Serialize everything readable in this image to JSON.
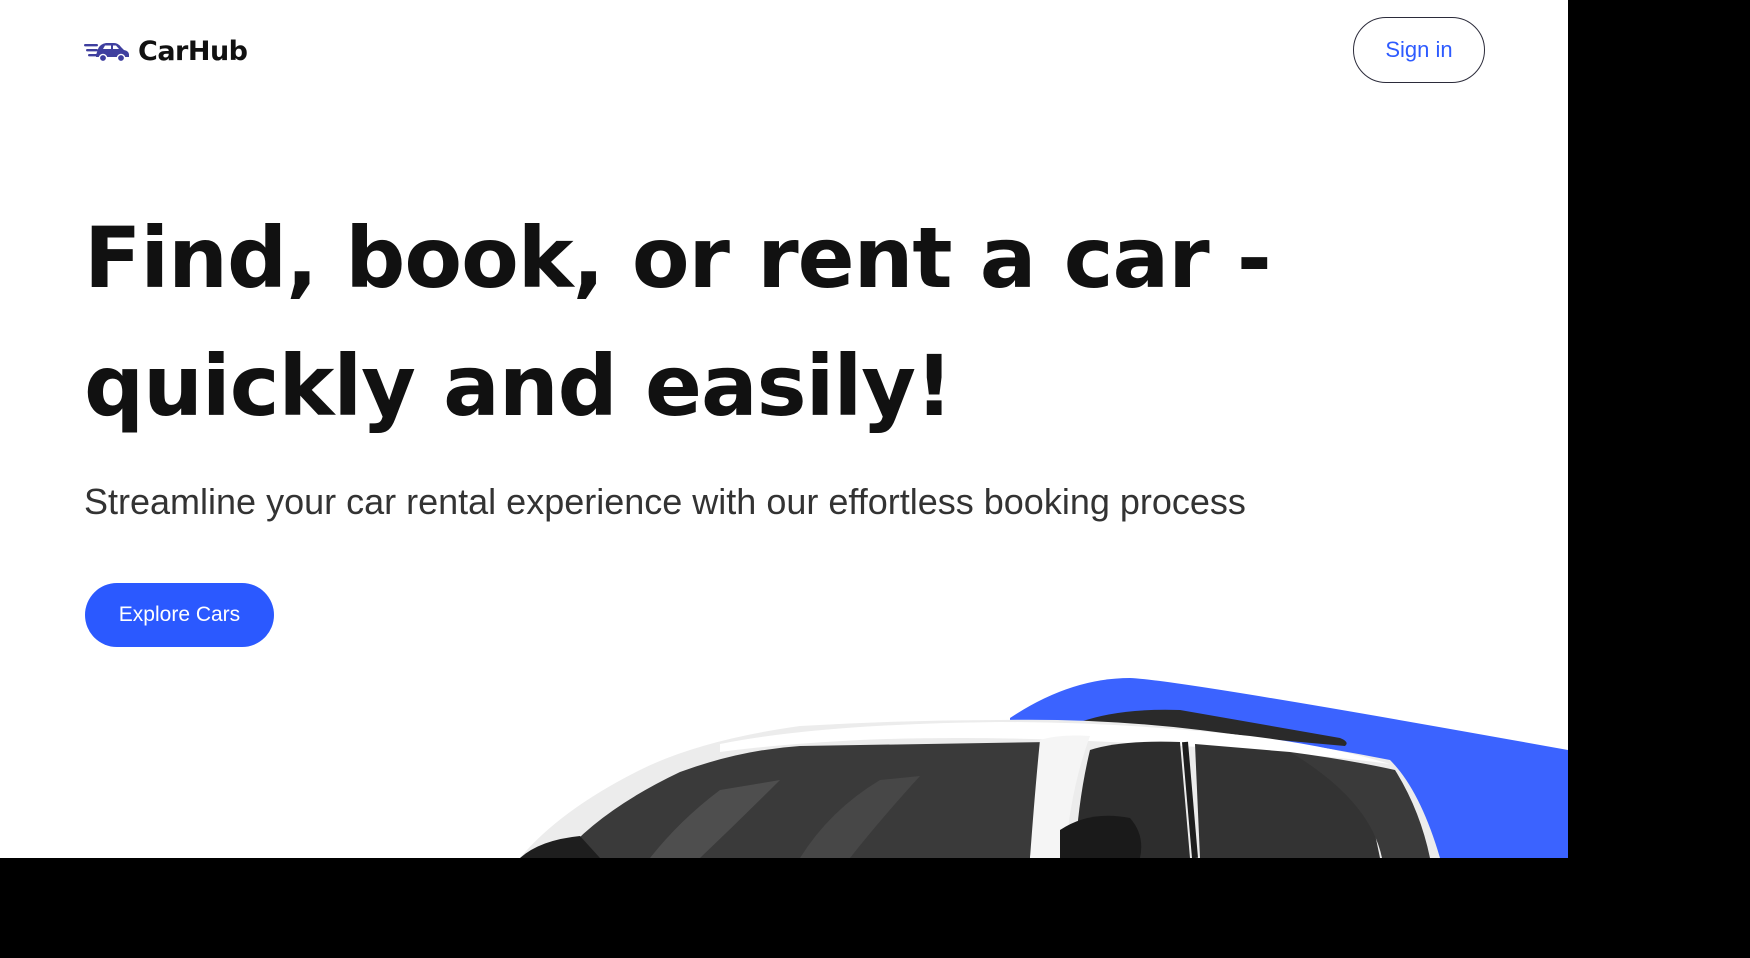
{
  "brand": {
    "name": "CarHub",
    "icon": "car-speed-icon",
    "color": "#3f3f9f"
  },
  "nav": {
    "signin_label": "Sign in"
  },
  "hero": {
    "title": "Find, book, or rent a car - quickly and easily!",
    "subtitle": "Streamline your car rental experience with our effortless booking process",
    "cta_label": "Explore Cars",
    "image": "white-suv-car-image"
  },
  "colors": {
    "accent": "#2b59ff",
    "background_blob": "#3b63ff",
    "text": "#111111"
  }
}
